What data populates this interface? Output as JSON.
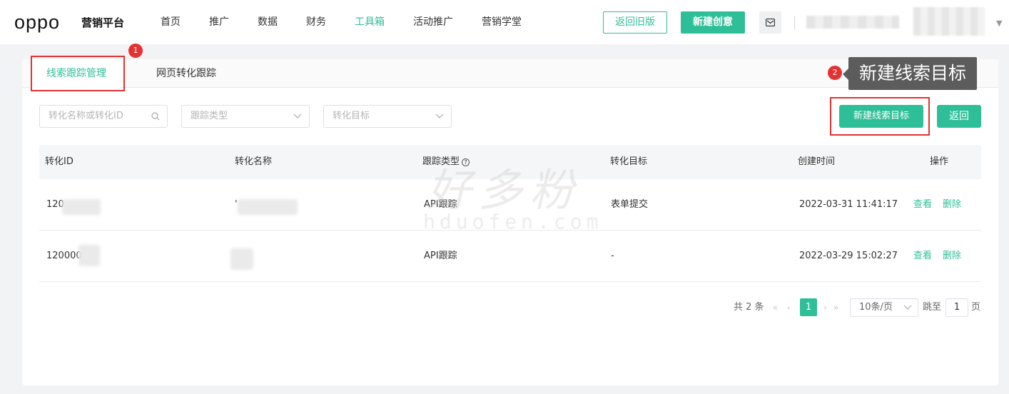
{
  "header": {
    "logo": "oppo",
    "brand": "营销平台",
    "nav": [
      "首页",
      "推广",
      "数据",
      "财务",
      "工具箱",
      "活动推广",
      "营销学堂"
    ],
    "active_nav": "工具箱",
    "back_old_label": "返回旧版",
    "new_creative_label": "新建创意",
    "mail_icon": "mail-icon"
  },
  "tabs": {
    "lead_tracking": "线索跟踪管理",
    "web_conversion": "网页转化跟踪"
  },
  "annotations": {
    "badge_1": "1",
    "badge_2": "2",
    "tooltip": "新建线索目标"
  },
  "filters": {
    "search_placeholder": "转化名称或转化ID",
    "track_type_placeholder": "跟踪类型",
    "conversion_goal_placeholder": "转化目标"
  },
  "actions": {
    "new_lead_goal": "新建线索目标",
    "back": "返回"
  },
  "table": {
    "columns": [
      "转化ID",
      "转化名称",
      "跟踪类型",
      "转化目标",
      "创建时间",
      "操作"
    ],
    "rows": [
      {
        "id": "120",
        "name": "'",
        "type": "API跟踪",
        "goal": "表单提交",
        "created": "2022-03-31 11:41:17",
        "view": "查看",
        "delete": "删除"
      },
      {
        "id": "120000",
        "name": "",
        "type": "API跟踪",
        "goal": "-",
        "created": "2022-03-29 15:02:27",
        "view": "查看",
        "delete": "删除"
      }
    ]
  },
  "pagination": {
    "total": "共 2 条",
    "current": "1",
    "page_size": "10条/页",
    "jump_label": "跳至",
    "jump_value": "1",
    "page_suffix": "页"
  },
  "watermark": {
    "cn": "好多粉",
    "en": "hduofen.com"
  },
  "colors": {
    "accent": "#2fbf98",
    "highlight": "#e33232"
  }
}
